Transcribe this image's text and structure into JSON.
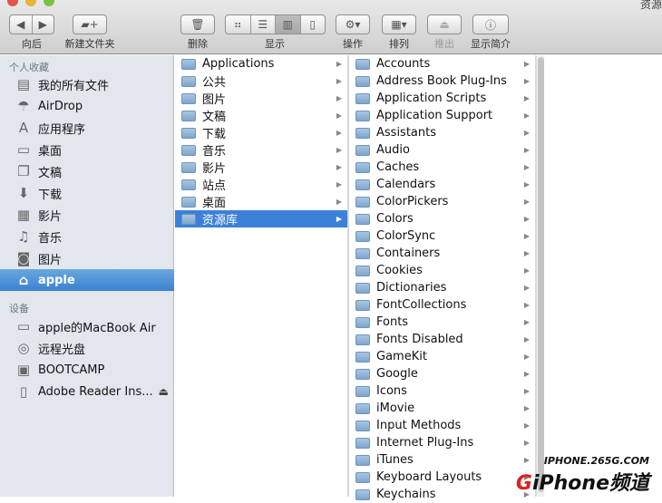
{
  "window": {
    "title": "资源"
  },
  "toolbar": {
    "back": "向后",
    "new_folder": "新建文件夹",
    "delete": "删除",
    "view": "显示",
    "action": "操作",
    "arrange": "排列",
    "eject": "推出",
    "info": "显示简介"
  },
  "sidebar": {
    "favorites_header": "个人收藏",
    "favorites": [
      {
        "label": "我的所有文件",
        "icon": "all-files-icon",
        "g": "▤"
      },
      {
        "label": "AirDrop",
        "icon": "airdrop-icon",
        "g": "☂"
      },
      {
        "label": "应用程序",
        "icon": "applications-icon",
        "g": "A"
      },
      {
        "label": "桌面",
        "icon": "desktop-icon",
        "g": "▭"
      },
      {
        "label": "文稿",
        "icon": "documents-icon",
        "g": "❐"
      },
      {
        "label": "下载",
        "icon": "downloads-icon",
        "g": "⬇"
      },
      {
        "label": "影片",
        "icon": "movies-icon",
        "g": "▦"
      },
      {
        "label": "音乐",
        "icon": "music-icon",
        "g": "♫"
      },
      {
        "label": "图片",
        "icon": "pictures-icon",
        "g": "◙"
      },
      {
        "label": "apple",
        "icon": "home-icon",
        "g": "⌂",
        "selected": true
      }
    ],
    "devices_header": "设备",
    "devices": [
      {
        "label": "apple的MacBook Air",
        "icon": "laptop-icon",
        "g": "▭"
      },
      {
        "label": "远程光盘",
        "icon": "disc-icon",
        "g": "◎"
      },
      {
        "label": "BOOTCAMP",
        "icon": "drive-icon",
        "g": "▣"
      },
      {
        "label": "Adobe Reader Ins...",
        "icon": "disk-image-icon",
        "g": "▯",
        "eject": "⏏"
      }
    ]
  },
  "column1": [
    "Applications",
    "公共",
    "图片",
    "文稿",
    "下载",
    "音乐",
    "影片",
    "站点",
    "桌面",
    "资源库"
  ],
  "column1_selected": "资源库",
  "column2": [
    "Accounts",
    "Address Book Plug-Ins",
    "Application Scripts",
    "Application Support",
    "Assistants",
    "Audio",
    "Caches",
    "Calendars",
    "ColorPickers",
    "Colors",
    "ColorSync",
    "Containers",
    "Cookies",
    "Dictionaries",
    "FontCollections",
    "Fonts",
    "Fonts Disabled",
    "GameKit",
    "Google",
    "Icons",
    "iMovie",
    "Input Methods",
    "Internet Plug-Ins",
    "iTunes",
    "Keyboard Layouts",
    "Keychains"
  ],
  "watermark": {
    "line1": "IPHONE.265G.COM",
    "line2": "GiPhone频道"
  },
  "colors": {
    "selection": "#3d80d8",
    "sidebar": "#e2e7ed",
    "watermark_red": "#e02020"
  }
}
